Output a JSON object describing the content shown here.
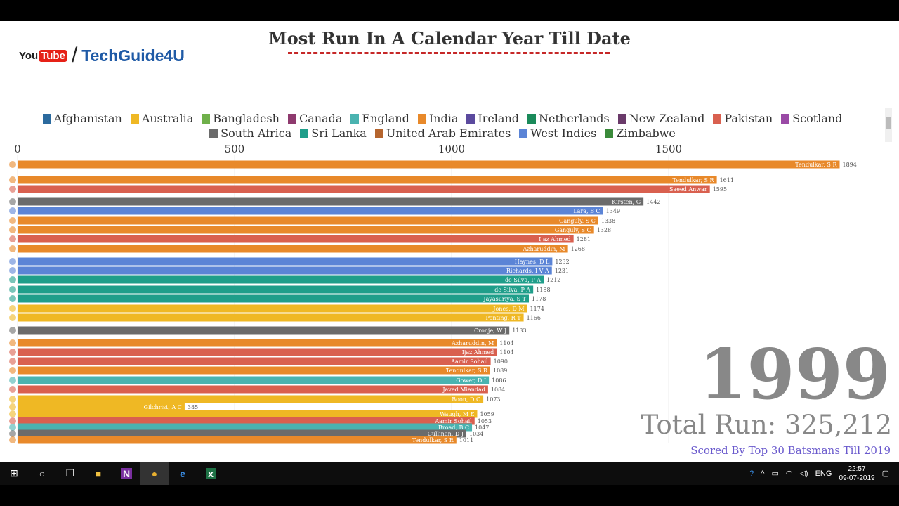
{
  "title": "Most Run In A Calendar Year Till Date",
  "logo": {
    "youtube_a": "You",
    "youtube_b": "Tube",
    "slash": "/",
    "brand": "TechGuide4U"
  },
  "legend": [
    {
      "name": "Afghanistan",
      "color": "#2b6a9e"
    },
    {
      "name": "Australia",
      "color": "#efb824"
    },
    {
      "name": "Bangladesh",
      "color": "#6fb04a"
    },
    {
      "name": "Canada",
      "color": "#8e3a6e"
    },
    {
      "name": "England",
      "color": "#4ab3b0"
    },
    {
      "name": "India",
      "color": "#e8892a"
    },
    {
      "name": "Ireland",
      "color": "#5b4a9e"
    },
    {
      "name": "Netherlands",
      "color": "#1a8a5a"
    },
    {
      "name": "New Zealand",
      "color": "#6a3a6a"
    },
    {
      "name": "Pakistan",
      "color": "#d9604f"
    },
    {
      "name": "Scotland",
      "color": "#9a4aa6"
    },
    {
      "name": "South Africa",
      "color": "#6b6b6b"
    },
    {
      "name": "Sri Lanka",
      "color": "#1f9e8a"
    },
    {
      "name": "United Arab Emirates",
      "color": "#b5652e"
    },
    {
      "name": "West Indies",
      "color": "#5b84d6"
    },
    {
      "name": "Zimbabwe",
      "color": "#3a8a3a"
    }
  ],
  "chart_data": {
    "type": "bar",
    "orientation": "horizontal",
    "title": "Most Run In A Calendar Year Till Date",
    "xlim": [
      0,
      1900
    ],
    "xticks": [
      0,
      500,
      1000,
      1500
    ],
    "grid": true,
    "legend_position": "top",
    "bars": [
      {
        "name": "Tendulkar, S R",
        "country": "India",
        "value": 1894
      },
      {
        "name": "Tendulkar, S R",
        "country": "India",
        "value": 1611
      },
      {
        "name": "Saeed Anwar",
        "country": "Pakistan",
        "value": 1595
      },
      {
        "name": "Kirsten, G",
        "country": "South Africa",
        "value": 1442
      },
      {
        "name": "Lara, B C",
        "country": "West Indies",
        "value": 1349
      },
      {
        "name": "Ganguly, S C",
        "country": "India",
        "value": 1338
      },
      {
        "name": "Ganguly, S C",
        "country": "India",
        "value": 1328
      },
      {
        "name": "Ijaz Ahmed",
        "country": "Pakistan",
        "value": 1281
      },
      {
        "name": "Azharuddin, M",
        "country": "India",
        "value": 1268
      },
      {
        "name": "Haynes, D L",
        "country": "West Indies",
        "value": 1232
      },
      {
        "name": "Richards, I V A",
        "country": "West Indies",
        "value": 1231
      },
      {
        "name": "de Silva, P A",
        "country": "Sri Lanka",
        "value": 1212
      },
      {
        "name": "de Silva, P A",
        "country": "Sri Lanka",
        "value": 1188
      },
      {
        "name": "Jayasuriya, S T",
        "country": "Sri Lanka",
        "value": 1178
      },
      {
        "name": "Jones, D M",
        "country": "Australia",
        "value": 1174
      },
      {
        "name": "Ponting, R T",
        "country": "Australia",
        "value": 1166
      },
      {
        "name": "Cronje, W J",
        "country": "South Africa",
        "value": 1133
      },
      {
        "name": "Azharuddin, M",
        "country": "India",
        "value": 1104
      },
      {
        "name": "Ijaz Ahmed",
        "country": "Pakistan",
        "value": 1104
      },
      {
        "name": "Aamir Sohail",
        "country": "Pakistan",
        "value": 1090
      },
      {
        "name": "Tendulkar, S R",
        "country": "India",
        "value": 1089
      },
      {
        "name": "Gower, D I",
        "country": "England",
        "value": 1086
      },
      {
        "name": "Javed Miandad",
        "country": "Pakistan",
        "value": 1084
      },
      {
        "name": "Boon, D C",
        "country": "Australia",
        "value": 1073
      },
      {
        "name": "Gilchrist, A C",
        "country": "Australia",
        "value": 385
      },
      {
        "name": "Waugh, M E",
        "country": "Australia",
        "value": 1059
      },
      {
        "name": "Aamir Sohail",
        "country": "Pakistan",
        "value": 1053
      },
      {
        "name": "Broad, B C",
        "country": "England",
        "value": 1047
      },
      {
        "name": "Cullinan, D J",
        "country": "South Africa",
        "value": 1034
      },
      {
        "name": "Tendulkar, S R",
        "country": "India",
        "value": 1011
      }
    ]
  },
  "year": "1999",
  "total": "Total Run: 325,212",
  "scored": "Scored By Top 30 Batsmans Till 2019",
  "taskbar": {
    "lang": "ENG",
    "time": "22:57",
    "date": "09-07-2019"
  }
}
